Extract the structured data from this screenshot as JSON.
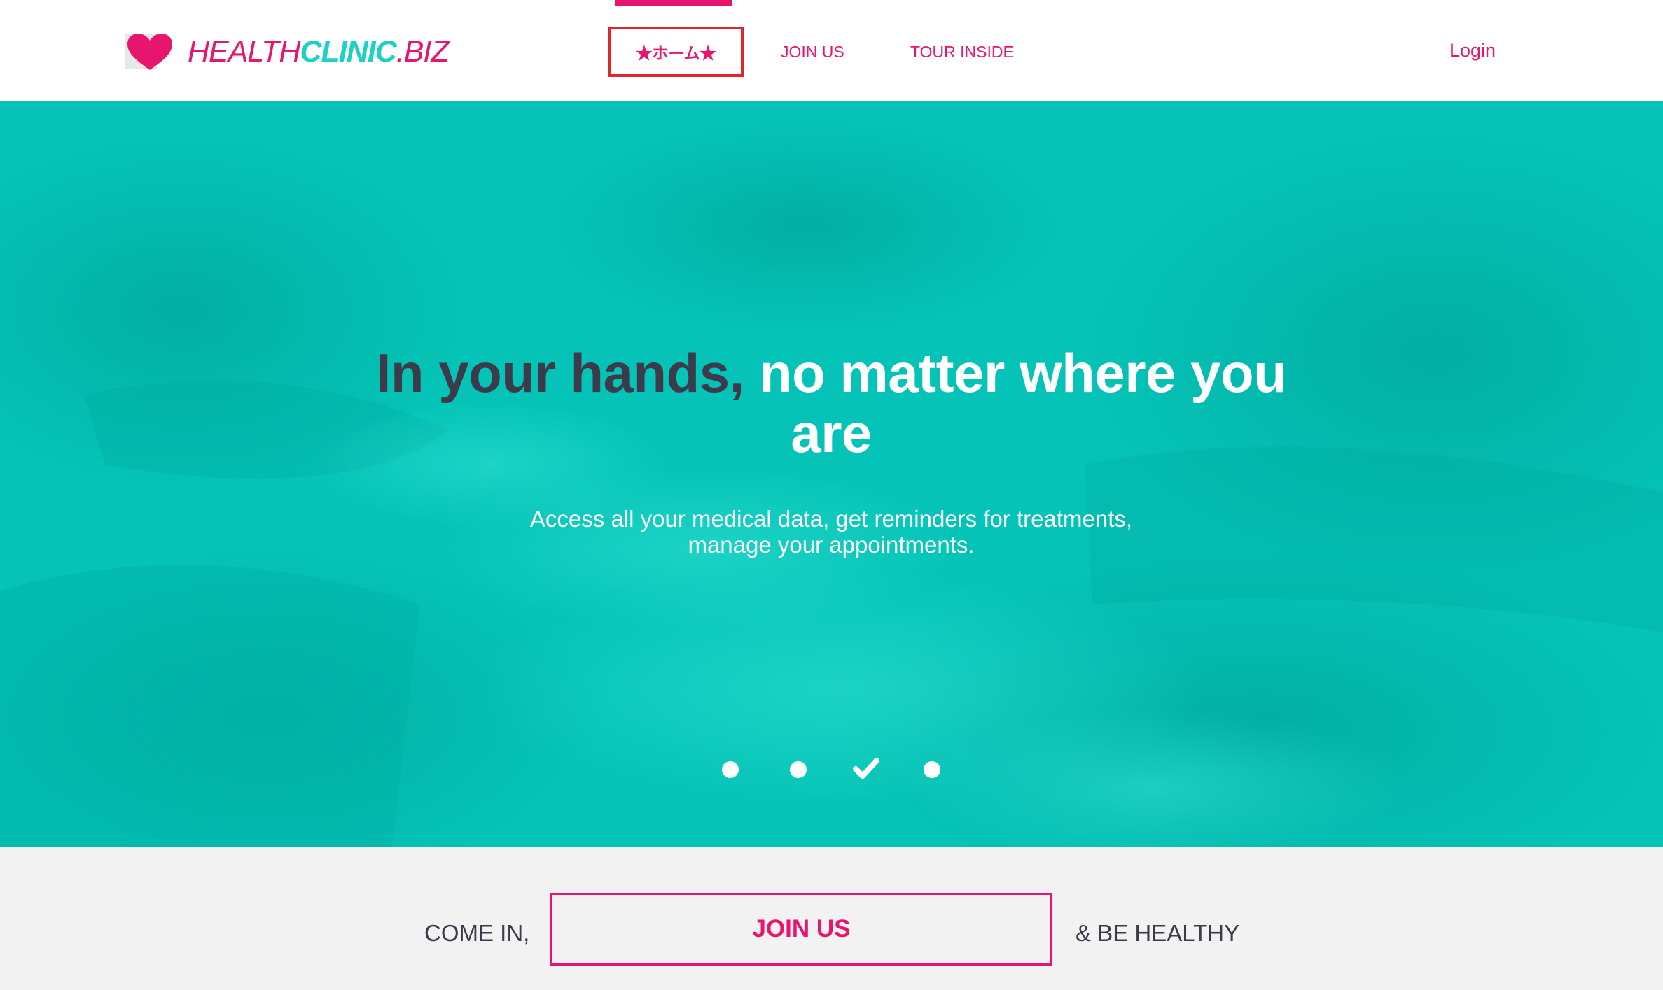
{
  "header": {
    "logo": {
      "icon": "heart-icon",
      "part1": "HEALTH",
      "part2": "CLINIC",
      "part3": ".BIZ"
    },
    "nav": [
      {
        "label": "★ホーム★",
        "active": true
      },
      {
        "label": "JOIN US",
        "active": false
      },
      {
        "label": "TOUR INSIDE",
        "active": false
      }
    ],
    "login_label": "Login"
  },
  "hero": {
    "title_dark": "In your hands,",
    "title_light": "no matter where you are",
    "subtitle_line1": "Access all your medical data, get reminders for treatments,",
    "subtitle_line2": "manage your appointments.",
    "carousel": {
      "slide_count": 4,
      "active_index": 3,
      "active_icon": "checkmark-icon"
    }
  },
  "cta": {
    "left_text": "COME IN,",
    "button_label": "JOIN US",
    "right_text": "& BE HEALTHY"
  },
  "colors": {
    "brand_pink": "#e8156f",
    "brand_teal": "#1dd1c3",
    "hero_teal": "#03c7ba",
    "dark_text": "#3b3b4c",
    "active_outline": "#e0262c"
  }
}
